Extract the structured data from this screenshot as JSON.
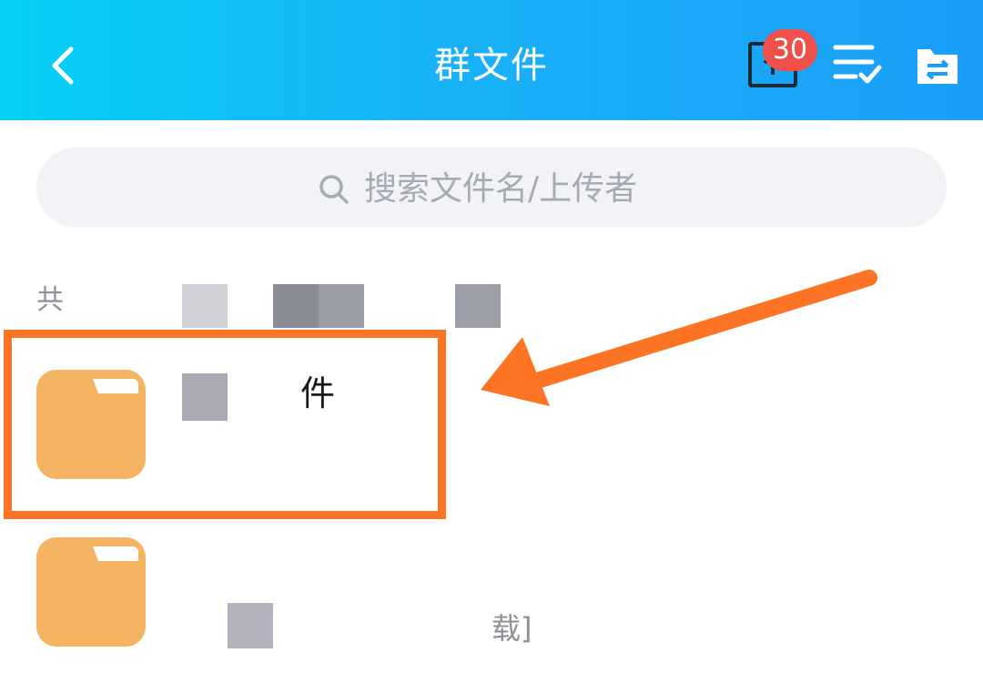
{
  "header": {
    "title": "群文件",
    "badge_count": "30",
    "back_icon": "chevron-left-icon",
    "upload_icon": "upload-icon",
    "sort_icon": "checklist-sort-icon",
    "transfer_icon": "transfer-folder-icon"
  },
  "search": {
    "placeholder": "搜索文件名/上传者",
    "icon": "search-icon"
  },
  "file_list": {
    "count_label": "共",
    "items": [
      {
        "name": "件",
        "icon": "folder-icon",
        "meta": ""
      },
      {
        "name": "",
        "icon": "folder-icon",
        "meta": "载]"
      }
    ]
  },
  "annotation": {
    "highlight_color": "#fd7425",
    "arrow_color": "#fd7425"
  },
  "colors": {
    "header_start": "#04d0f5",
    "header_end": "#1a9ef8",
    "badge": "#f0504a",
    "folder": "#f5b462"
  }
}
